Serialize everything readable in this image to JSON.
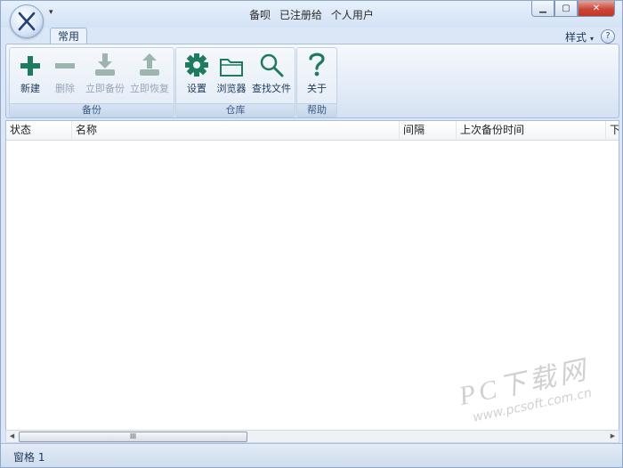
{
  "window": {
    "title_parts": [
      "备呗",
      "已注册给",
      "个人用户"
    ],
    "min_glyph": "▁",
    "max_glyph": "▢",
    "close_glyph": "✕"
  },
  "tabs": [
    {
      "label": "常用",
      "active": true
    }
  ],
  "style_menu": {
    "label": "样式"
  },
  "help_glyph": "?",
  "ribbon": {
    "groups": [
      {
        "label": "备份",
        "buttons": [
          {
            "label": "新建",
            "icon": "plus-icon",
            "enabled": true
          },
          {
            "label": "删除",
            "icon": "minus-icon",
            "enabled": false
          },
          {
            "label": "立即备份",
            "icon": "download-icon",
            "enabled": false
          },
          {
            "label": "立即恢复",
            "icon": "upload-icon",
            "enabled": false
          }
        ]
      },
      {
        "label": "仓库",
        "buttons": [
          {
            "label": "设置",
            "icon": "gear-icon",
            "enabled": true
          },
          {
            "label": "浏览器",
            "icon": "folder-icon",
            "enabled": true
          },
          {
            "label": "查找文件",
            "icon": "search-icon",
            "enabled": true
          }
        ]
      },
      {
        "label": "帮助",
        "buttons": [
          {
            "label": "关于",
            "icon": "question-icon",
            "enabled": true
          }
        ]
      }
    ]
  },
  "list": {
    "columns": [
      "状态",
      "名称",
      "间隔",
      "上次备份时间",
      "下"
    ],
    "rows": []
  },
  "scrollbar": {
    "thumb_glyph": "III"
  },
  "statusbar": {
    "text": "窗格 1"
  },
  "watermark": {
    "main": "PC下载网",
    "sub": "www.pcsoft.com.cn"
  },
  "colors": {
    "accent": "#1e7b5e",
    "icon_disabled": "#9cb6ad",
    "title_bg": "#dbe7f6"
  }
}
